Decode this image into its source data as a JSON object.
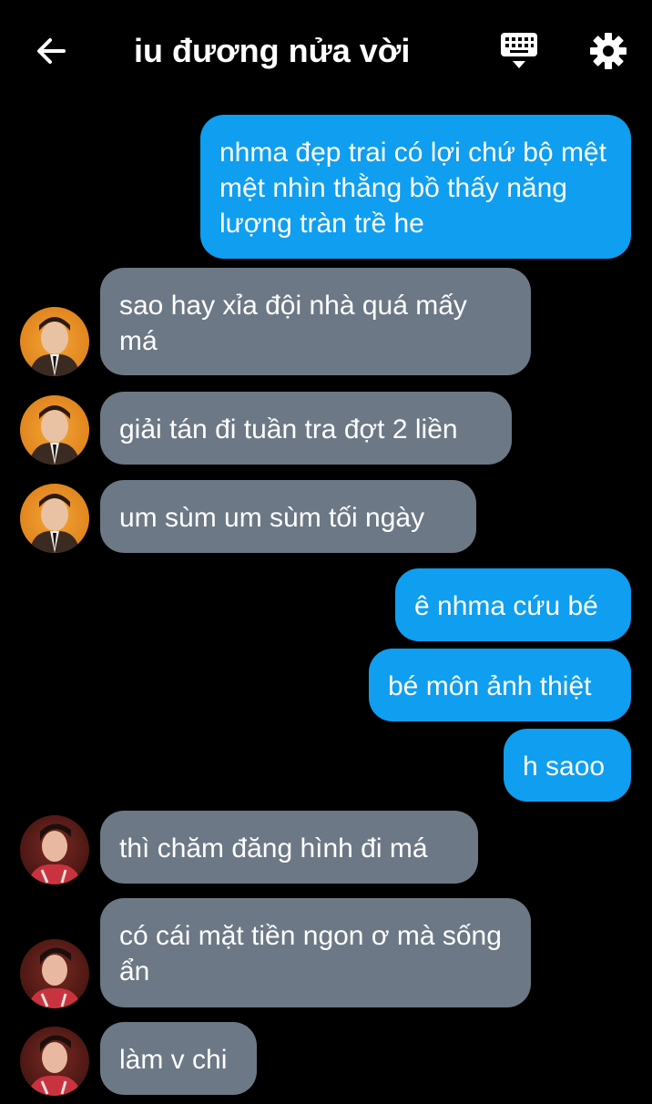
{
  "header": {
    "back_icon": "arrow-left-icon",
    "title": "iu đương nửa vời",
    "keyboard_icon": "keyboard-icon",
    "settings_icon": "gear-icon"
  },
  "colors": {
    "background": "#000000",
    "sent_bubble": "#0f9ef0",
    "received_bubble": "#6c7885",
    "text": "#ffffff"
  },
  "messages": [
    {
      "direction": "sent",
      "text": "nhma đẹp trai có lợi chứ bộ mệt mệt nhìn thằng bồ thấy năng lượng tràn trề he"
    },
    {
      "direction": "received",
      "avatar": "avatar-a",
      "text": "sao hay xỉa đội nhà quá mấy má"
    },
    {
      "direction": "received",
      "avatar": "avatar-a",
      "text": "giải tán đi tuần tra đợt 2 liền"
    },
    {
      "direction": "received",
      "avatar": "avatar-a",
      "text": "um sùm um sùm tối ngày"
    },
    {
      "direction": "sent",
      "text": "ê nhma cứu bé"
    },
    {
      "direction": "sent",
      "text": "bé môn ảnh thiệt"
    },
    {
      "direction": "sent",
      "text": "h saoo"
    },
    {
      "direction": "received",
      "avatar": "avatar-b",
      "text": "thì chăm đăng hình đi má"
    },
    {
      "direction": "received",
      "avatar": "avatar-b",
      "text": "có cái mặt tiền ngon ơ mà sống ẩn"
    },
    {
      "direction": "received",
      "avatar": "avatar-b",
      "text": "làm v chi"
    }
  ]
}
